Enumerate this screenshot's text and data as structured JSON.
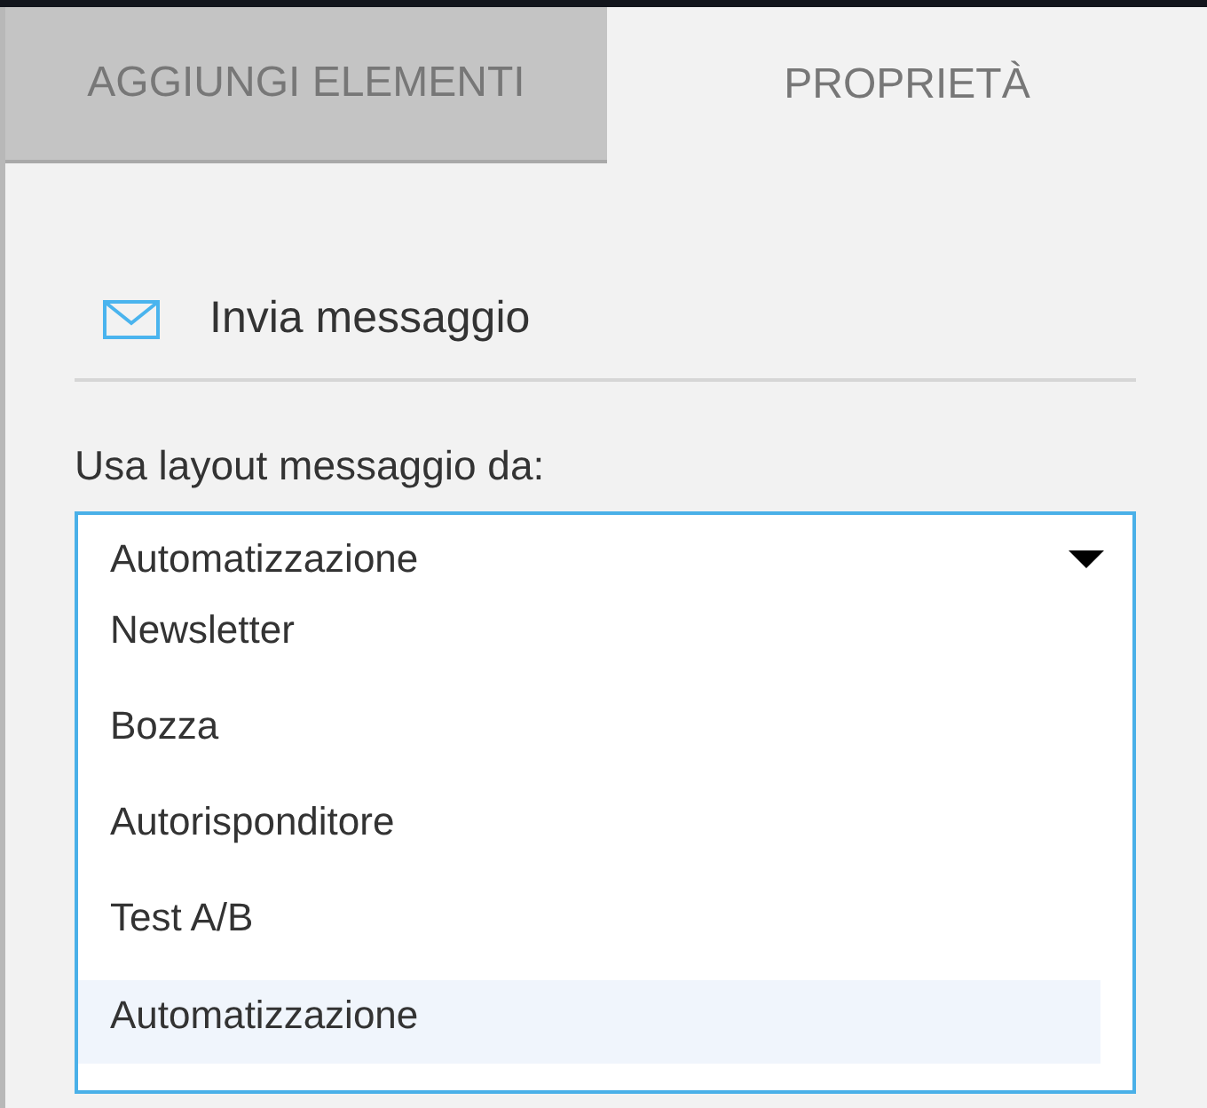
{
  "tabs": [
    {
      "label": "AGGIUNGI ELEMENTI",
      "selected": false
    },
    {
      "label": "PROPRIETÀ",
      "selected": true
    }
  ],
  "action": {
    "label": "Invia messaggio"
  },
  "layout_select": {
    "label": "Usa layout messaggio da:",
    "value": "Automatizzazione",
    "expanded": true,
    "options": [
      {
        "label": "Newsletter",
        "selected": false
      },
      {
        "label": "Bozza",
        "selected": false
      },
      {
        "label": "Autorisponditore",
        "selected": false
      },
      {
        "label": "Test A/B",
        "selected": false
      },
      {
        "label": "Automatizzazione",
        "selected": true
      }
    ]
  }
}
